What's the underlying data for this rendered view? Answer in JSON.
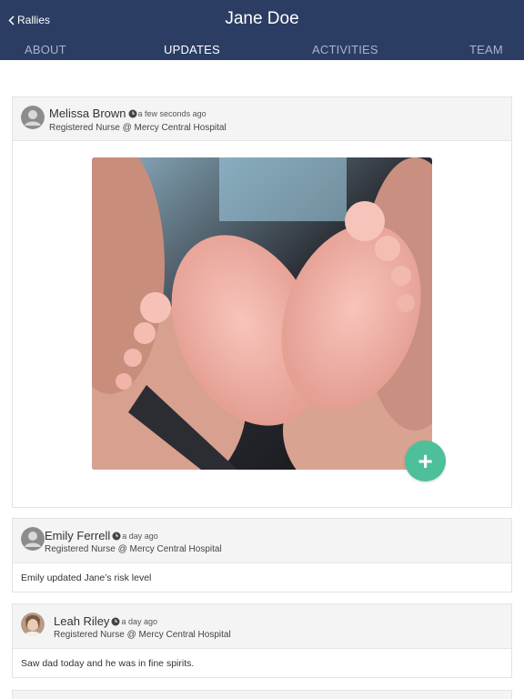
{
  "header": {
    "back_label": "Rallies",
    "title": "Jane Doe",
    "tabs": [
      {
        "label": "ABOUT"
      },
      {
        "label": "UPDATES"
      },
      {
        "label": "ACTIVITIES"
      },
      {
        "label": "TEAM"
      }
    ],
    "active_tab": "UPDATES",
    "bg_color": "#2b3d63"
  },
  "feed": [
    {
      "author": "Melissa Brown",
      "time": "a few seconds ago",
      "role": "Registered Nurse @ Mercy Central Hospital",
      "avatar": "default-avatar-icon",
      "image": "baby-feet-photo",
      "fab_label": "+"
    },
    {
      "author": "Emily Ferrell",
      "time": "a day ago",
      "role": "Registered Nurse @ Mercy Central Hospital",
      "avatar": "default-avatar-icon",
      "text": "Emily updated Jane’s risk level"
    },
    {
      "author": "Leah Riley",
      "time": "a day ago",
      "role": "Registered Nurse @ Mercy Central Hospital",
      "avatar": "profile-photo",
      "text": "Saw dad today and he was in fine spirits."
    }
  ],
  "colors": {
    "accent": "#4dbf9b",
    "card_header": "#f4f4f4"
  }
}
